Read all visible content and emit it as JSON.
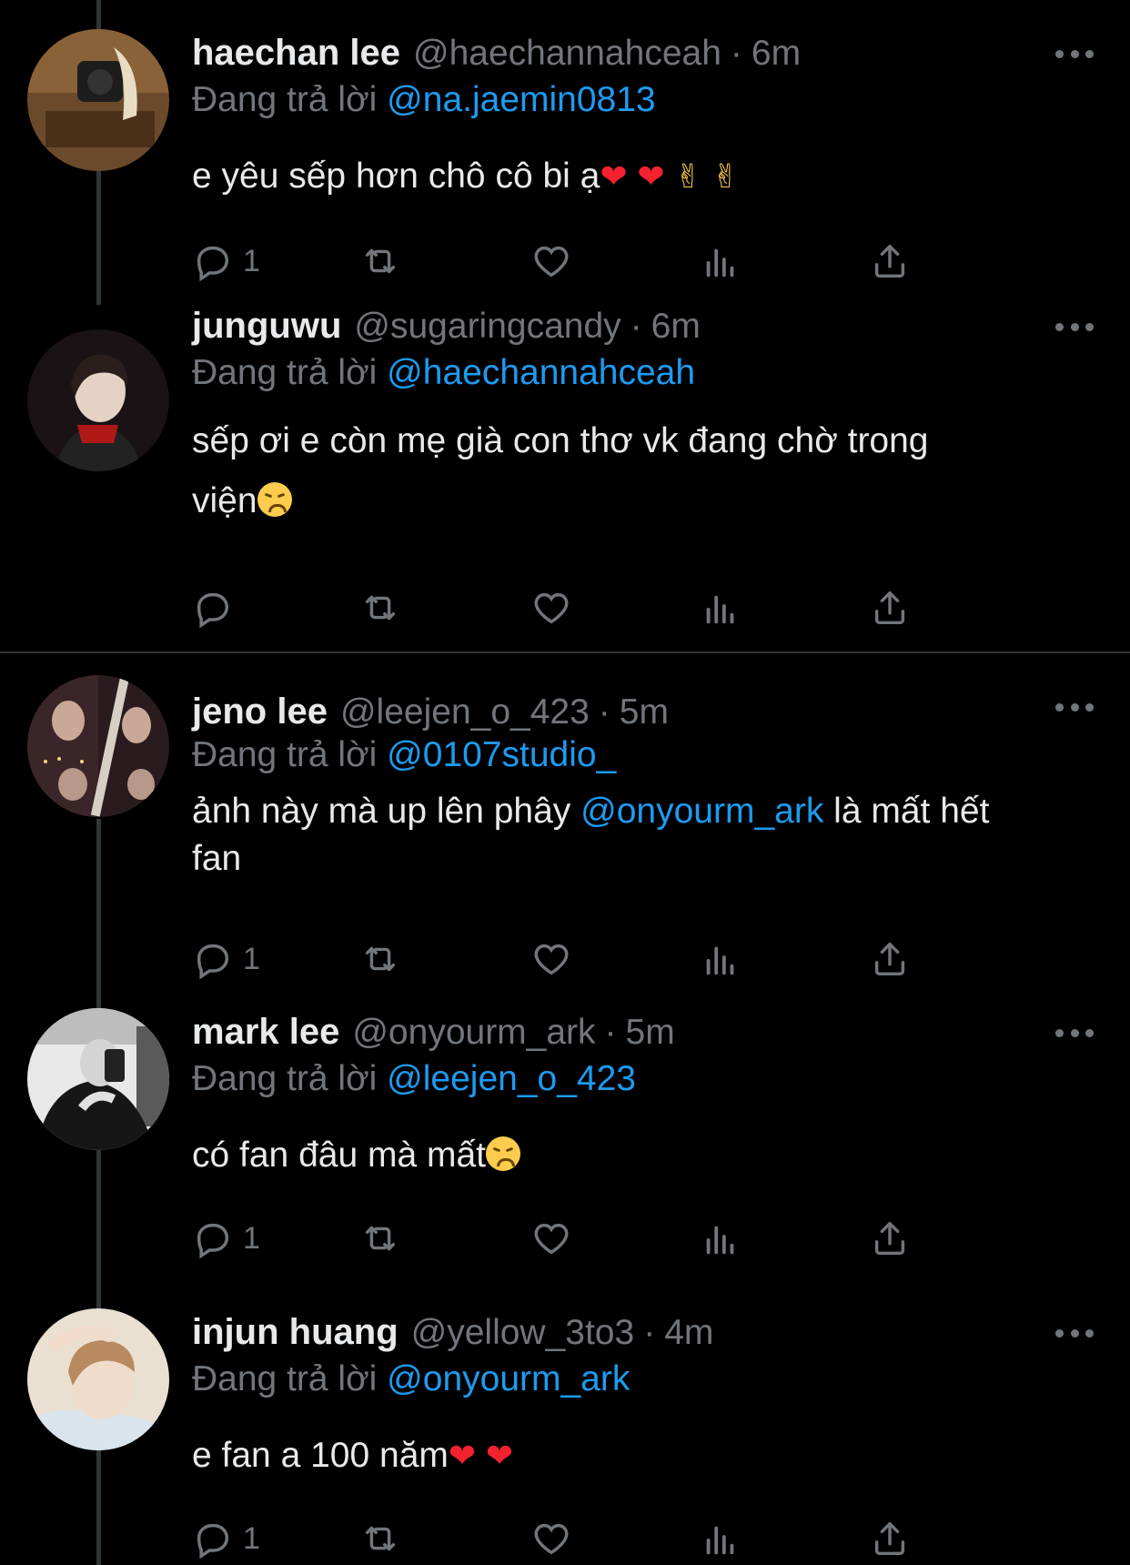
{
  "tweets": [
    {
      "name": "haechan lee",
      "handle": "@haechannahceah",
      "time": "6m",
      "reply_label": "Đang trả lời",
      "reply_to": "@na.jaemin0813",
      "text_parts": [
        "e yêu sếp hơn chô cô bi ạ"
      ],
      "reply_count": "1",
      "emojis": [
        "red-heart",
        "red-heart",
        "crossed-fingers",
        "crossed-fingers"
      ]
    },
    {
      "name": "junguwu",
      "handle": "@sugaringcandy",
      "time": "6m",
      "reply_label": "Đang trả lời",
      "reply_to": "@haechannahceah",
      "text_parts": [
        "sếp ơi e còn mẹ già con thơ vk đang chờ trong",
        "viện"
      ],
      "reply_count": "",
      "emojis": [
        "disappointed-face"
      ]
    },
    {
      "name": "jeno lee",
      "handle": "@leejen_o_423",
      "time": "5m",
      "reply_label": "Đang trả lời",
      "reply_to": "@0107studio_",
      "text_parts": [
        "ảnh này mà up lên phây ",
        "@onyourm_ark",
        " là mất hết",
        "fan"
      ],
      "reply_count": "1",
      "emojis": []
    },
    {
      "name": "mark lee",
      "handle": "@onyourm_ark",
      "time": "5m",
      "reply_label": "Đang trả lời",
      "reply_to": "@leejen_o_423",
      "text_parts": [
        "có fan đâu mà mất"
      ],
      "reply_count": "1",
      "emojis": [
        "disappointed-face"
      ]
    },
    {
      "name": "injun huang",
      "handle": "@yellow_3to3",
      "time": "4m",
      "reply_label": "Đang trả lời",
      "reply_to": "@onyourm_ark",
      "text_parts": [
        "e fan a 100 năm"
      ],
      "reply_count": "1",
      "emojis": [
        "red-heart",
        "red-heart"
      ]
    }
  ],
  "colors": {
    "background": "#000000",
    "text": "#e7e9ea",
    "muted": "#71767b",
    "link": "#1d9bf0",
    "thread_line": "#333639"
  },
  "icons": [
    "reply-icon",
    "retweet-icon",
    "like-icon",
    "views-icon",
    "share-icon",
    "more-icon"
  ]
}
